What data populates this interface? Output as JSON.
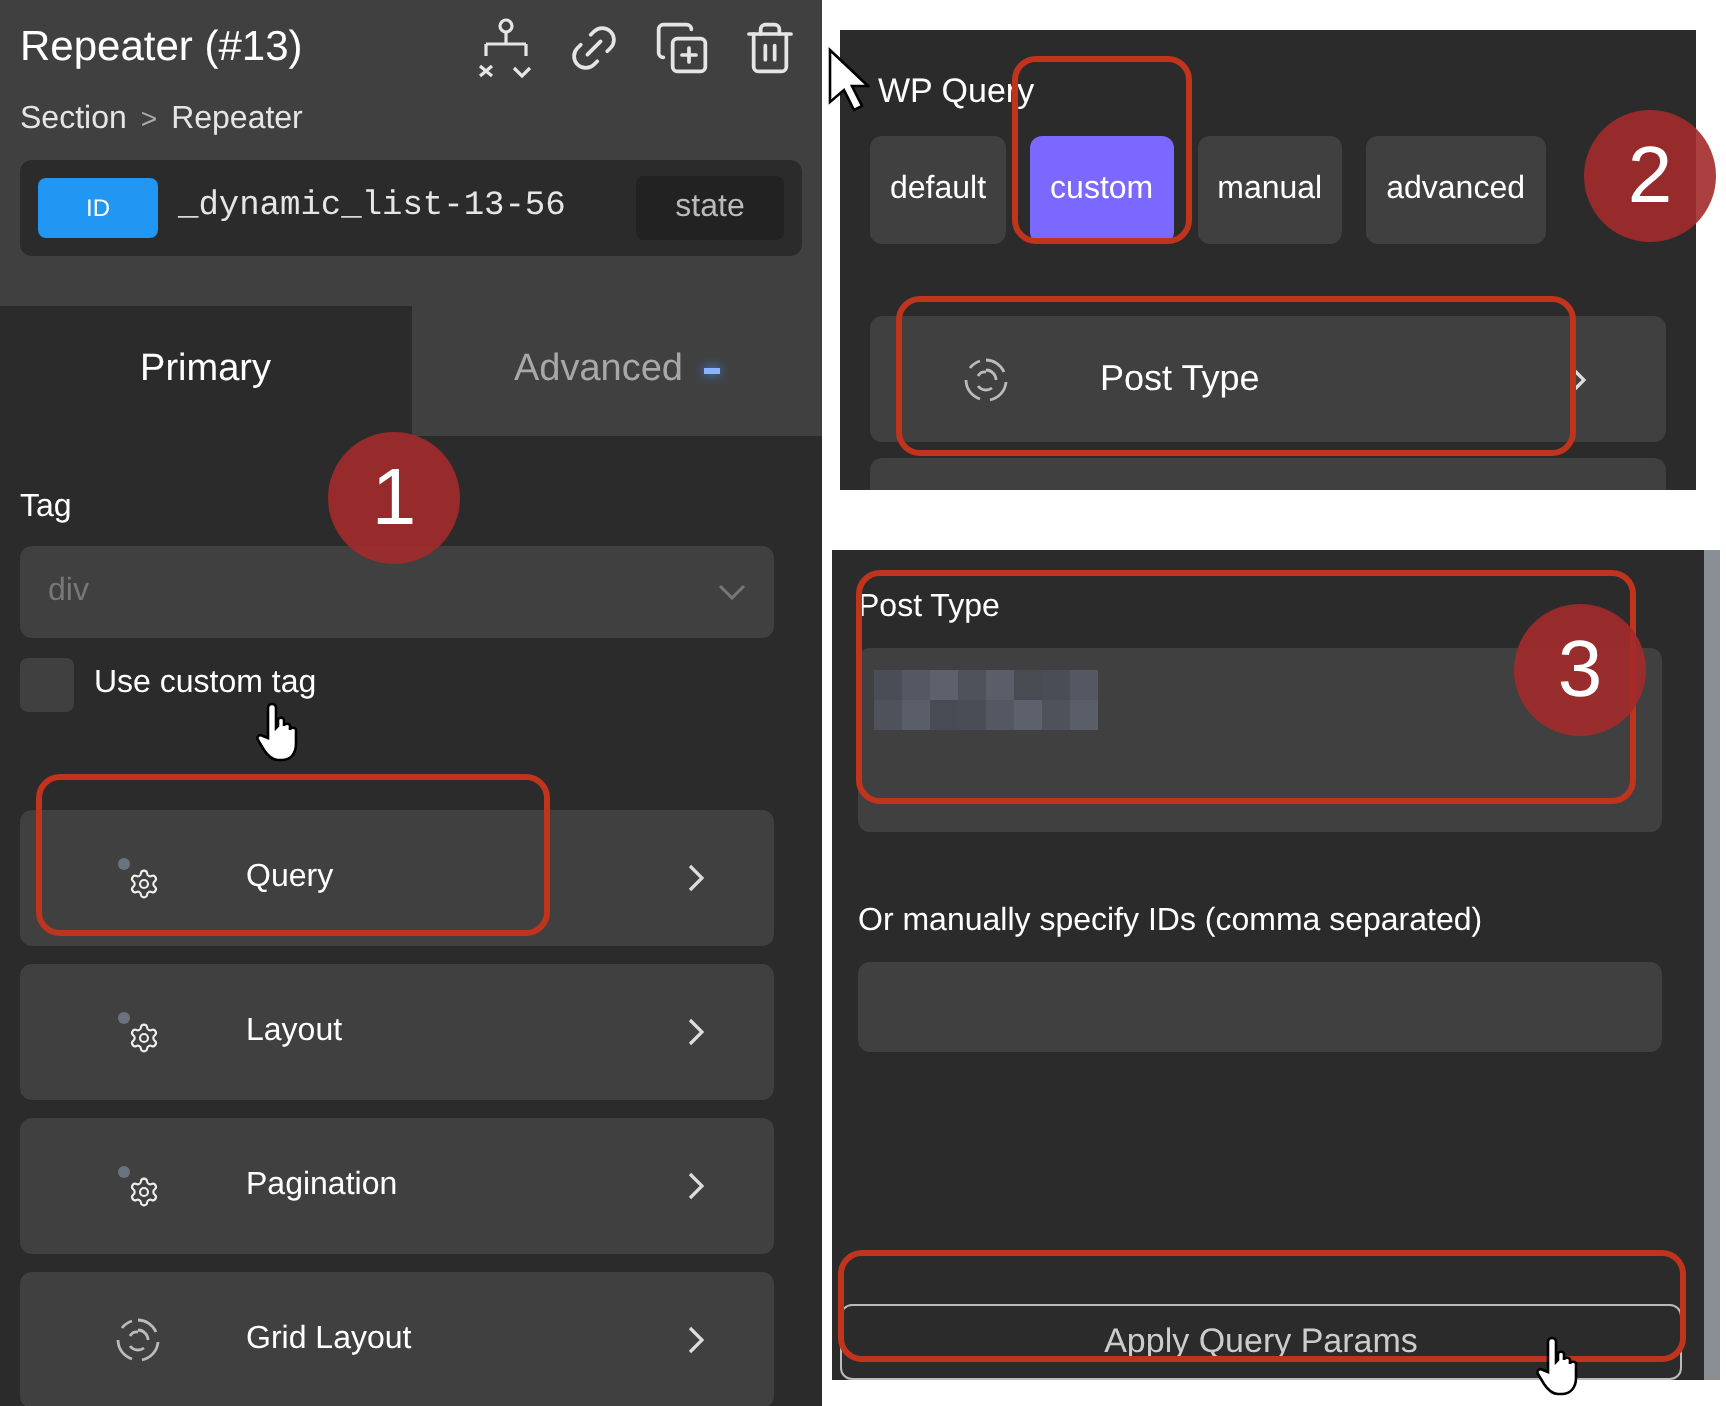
{
  "element_panel": {
    "title": "Repeater (#13)",
    "breadcrumb": [
      "Section",
      ">",
      "Repeater"
    ],
    "id_badge": "ID",
    "element_id": "_dynamic_list-13-56",
    "state_button": "state",
    "tabs": [
      {
        "label": "Primary",
        "selected": true,
        "modified": false
      },
      {
        "label": "Advanced",
        "selected": false,
        "modified": true
      }
    ],
    "tag_label": "Tag",
    "tag_select": {
      "value": "div",
      "disabled": true
    },
    "custom_tag": {
      "label": "Use custom tag",
      "checked": false
    },
    "sections": [
      {
        "label": "Query",
        "kind": "gear"
      },
      {
        "label": "Layout",
        "kind": "gear"
      },
      {
        "label": "Pagination",
        "kind": "gear"
      },
      {
        "label": "Grid Layout",
        "kind": "spiral"
      }
    ],
    "callout": "1"
  },
  "query_panel": {
    "label": "WP Query",
    "modes": [
      {
        "label": "default",
        "selected": false
      },
      {
        "label": "custom",
        "selected": true
      },
      {
        "label": "manual",
        "selected": false
      },
      {
        "label": "advanced",
        "selected": false
      }
    ],
    "row": {
      "label": "Post Type",
      "kind": "spiral"
    },
    "callout": "2"
  },
  "post_type_panel": {
    "post_type_label": "Post Type",
    "ids_label": "Or manually specify IDs (comma separated)",
    "apply_button": "Apply Query Params",
    "callout": "3"
  }
}
